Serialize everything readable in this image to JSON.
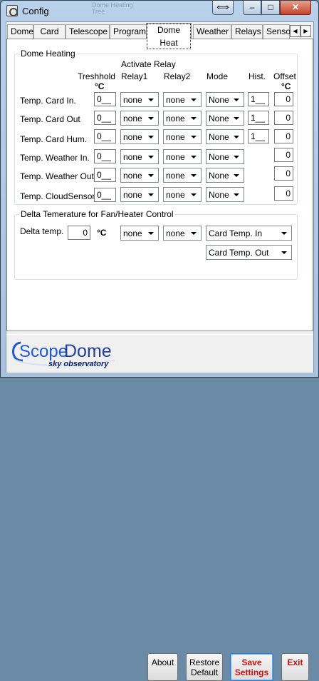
{
  "window": {
    "title": "Config",
    "ghost_title_line1": "Dome Heating",
    "ghost_title_line2": "Tree",
    "restore_toggle": "⟺",
    "minimize": "–",
    "maximize": "□",
    "close": "✕"
  },
  "tabs": [
    {
      "label": "Dome",
      "active": false
    },
    {
      "label": "Card",
      "active": false
    },
    {
      "label": "Telescope",
      "active": false
    },
    {
      "label": "Program",
      "active": false
    },
    {
      "label": "Dome Heat",
      "active": true
    },
    {
      "label": "Weather",
      "active": false
    },
    {
      "label": "Relays",
      "active": false
    },
    {
      "label": "Senso",
      "active": false
    }
  ],
  "tab_scroll": {
    "left": "◀",
    "right": "▶"
  },
  "dome_heating": {
    "title": "Dome Heating",
    "activate_relay": "Activate Relay",
    "headers": {
      "threshold": "Treshhold",
      "threshold_unit": "°C",
      "relay1": "Relay1",
      "relay2": "Relay2",
      "mode": "Mode",
      "hist": "Hist.",
      "offset": "Offset",
      "offset_unit": "°C"
    },
    "rows": [
      {
        "label": "Temp. Card In.",
        "threshold": "0__",
        "relay1": "none",
        "relay2": "none",
        "mode": "None",
        "hist": "1__",
        "offset": "0"
      },
      {
        "label": "Temp. Card Out",
        "threshold": "0__",
        "relay1": "none",
        "relay2": "none",
        "mode": "None",
        "hist": "1__",
        "offset": "0"
      },
      {
        "label": "Temp. Card Hum.",
        "threshold": "0__",
        "relay1": "none",
        "relay2": "none",
        "mode": "None",
        "hist": "1__",
        "offset": "0"
      },
      {
        "label": "Temp. Weather In.",
        "threshold": "0__",
        "relay1": "none",
        "relay2": "none",
        "mode": "None",
        "offset": "0"
      },
      {
        "label": "Temp. Weather Out",
        "threshold": "0__",
        "relay1": "none",
        "relay2": "none",
        "mode": "None",
        "offset": "0"
      },
      {
        "label": "Temp. CloudSensor",
        "threshold": "0__",
        "relay1": "none",
        "relay2": "none",
        "mode": "None",
        "offset": "0"
      }
    ]
  },
  "delta": {
    "title": "Delta Temerature for Fan/Heater Control",
    "label": "Delta temp.",
    "value": "0",
    "unit": "°C",
    "relay1": "none",
    "relay2": "none",
    "sensor_a": "Card Temp. In",
    "sensor_b": "Card Temp. Out"
  },
  "logo": {
    "brand_prefix": "Scope",
    "brand_suffix": "Dome",
    "tagline": "sky observatory",
    "accent": "#1f57d6"
  },
  "buttons": {
    "about": "About",
    "restore_default_1": "Restore",
    "restore_default_2": "Default",
    "save_1": "Save",
    "save_2": "Settings",
    "exit": "Exit"
  }
}
